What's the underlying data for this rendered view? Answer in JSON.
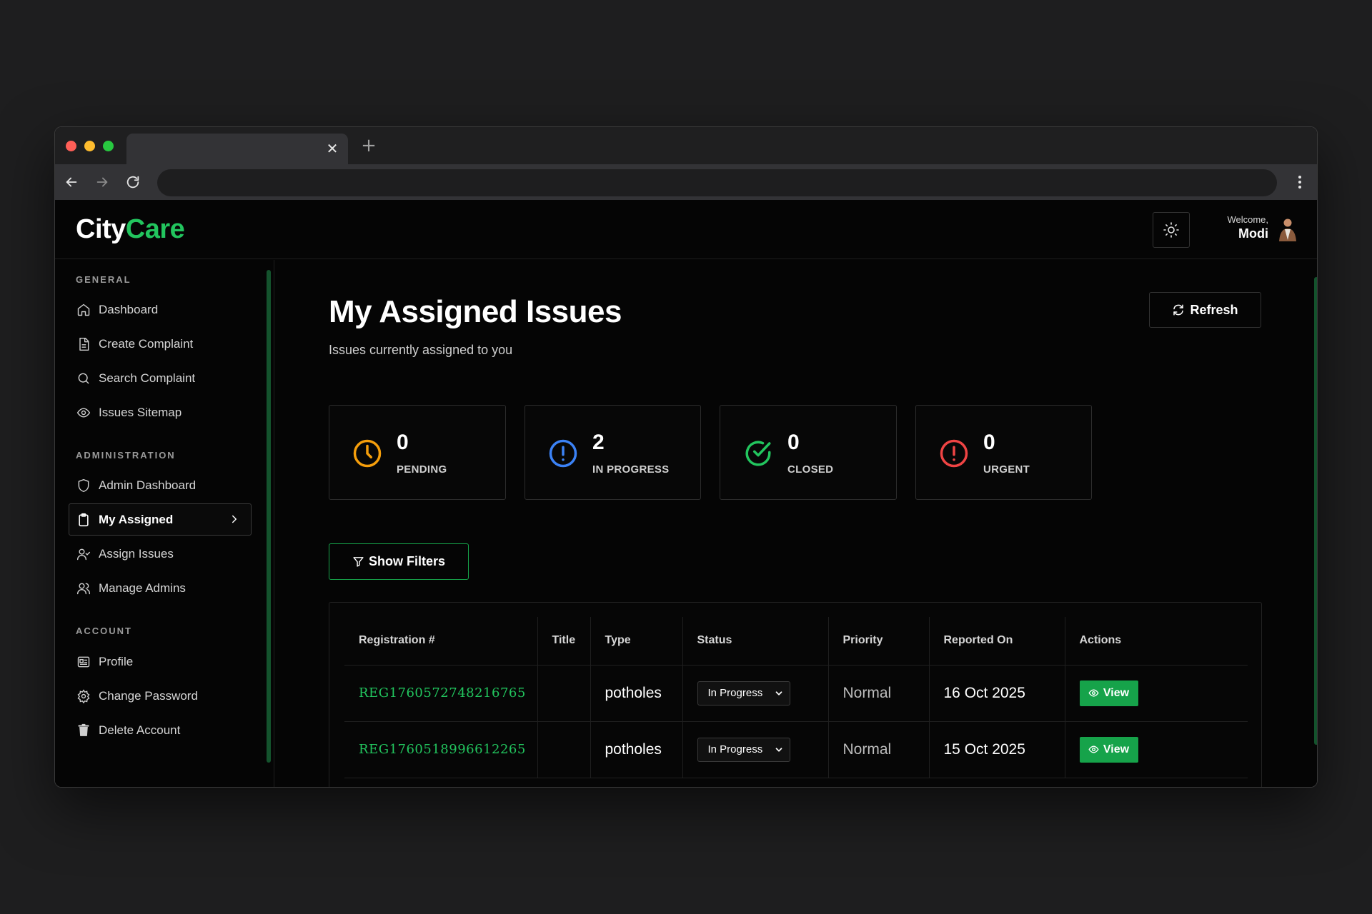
{
  "browser": {
    "tab_close": "✕",
    "new_tab": "+"
  },
  "header": {
    "logo_part1": "City",
    "logo_part2": "Care",
    "welcome_label": "Welcome,",
    "user_name": "Modi"
  },
  "sidebar": {
    "sections": [
      {
        "title": "GENERAL",
        "items": [
          {
            "label": "Dashboard",
            "icon": "home-icon"
          },
          {
            "label": "Create Complaint",
            "icon": "document-icon"
          },
          {
            "label": "Search Complaint",
            "icon": "search-icon"
          },
          {
            "label": "Issues Sitemap",
            "icon": "eye-icon"
          }
        ]
      },
      {
        "title": "ADMINISTRATION",
        "items": [
          {
            "label": "Admin Dashboard",
            "icon": "shield-icon"
          },
          {
            "label": "My Assigned",
            "icon": "clipboard-icon",
            "active": true
          },
          {
            "label": "Assign Issues",
            "icon": "user-check-icon"
          },
          {
            "label": "Manage Admins",
            "icon": "users-icon"
          }
        ]
      },
      {
        "title": "ACCOUNT",
        "items": [
          {
            "label": "Profile",
            "icon": "id-card-icon"
          },
          {
            "label": "Change Password",
            "icon": "gear-icon"
          },
          {
            "label": "Delete Account",
            "icon": "trash-icon"
          }
        ]
      }
    ]
  },
  "main": {
    "title": "My Assigned Issues",
    "subtitle": "Issues currently assigned to you",
    "refresh_label": "Refresh",
    "filters_label": "Show Filters",
    "stats": [
      {
        "value": "0",
        "label": "PENDING",
        "icon": "clock-icon",
        "color": "#f59e0b"
      },
      {
        "value": "2",
        "label": "IN PROGRESS",
        "icon": "alert-circle-icon",
        "color": "#3b82f6"
      },
      {
        "value": "0",
        "label": "CLOSED",
        "icon": "check-circle-icon",
        "color": "#22c55e"
      },
      {
        "value": "0",
        "label": "URGENT",
        "icon": "alert-circle-icon",
        "color": "#ef4444"
      }
    ],
    "table": {
      "columns": [
        "Registration #",
        "Title",
        "Type",
        "Status",
        "Priority",
        "Reported On",
        "Actions"
      ],
      "rows": [
        {
          "registration": "REG1760572748216765",
          "title": "",
          "type": "potholes",
          "status": "In Progress",
          "priority": "Normal",
          "reported_on": "16 Oct 2025",
          "action": "View"
        },
        {
          "registration": "REG1760518996612265",
          "title": "",
          "type": "potholes",
          "status": "In Progress",
          "priority": "Normal",
          "reported_on": "15 Oct 2025",
          "action": "View"
        }
      ]
    }
  },
  "colors": {
    "accent": "#22c55e",
    "background": "#050505",
    "desktop": "#1e1e1f"
  }
}
